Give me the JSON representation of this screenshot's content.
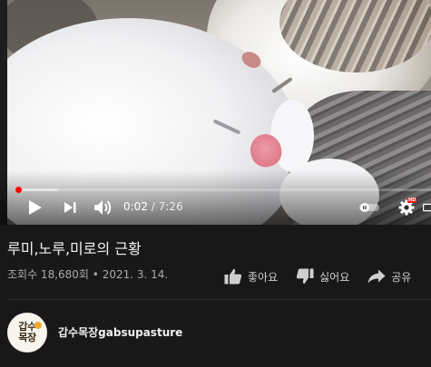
{
  "player": {
    "progress_fraction": 0.0047,
    "buffer_fraction": 0.1,
    "time_current": "0:02",
    "time_separator": " / ",
    "time_total": "7:26",
    "hd_badge": "HD",
    "colors": {
      "progress": "#ff0000",
      "hd_badge": "#e31b1b"
    },
    "icons": [
      "play-icon",
      "next-icon",
      "volume-icon",
      "autoplay-toggle-icon",
      "settings-gear-icon",
      "theater-mode-icon"
    ]
  },
  "video": {
    "title": "루미,노루,미로의 근황",
    "views": "조회수 18,680회",
    "meta_separator": " • ",
    "date": "2021. 3. 14."
  },
  "actions": {
    "like_label": "좋아요",
    "dislike_label": "싫어요",
    "share_label": "공유",
    "icons": [
      "thumbs-up-icon",
      "thumbs-down-icon",
      "share-arrow-icon"
    ]
  },
  "channel": {
    "name": "갑수목장gabsupasture",
    "avatar_text_line1": "갑수",
    "avatar_text_line2": "목장"
  }
}
